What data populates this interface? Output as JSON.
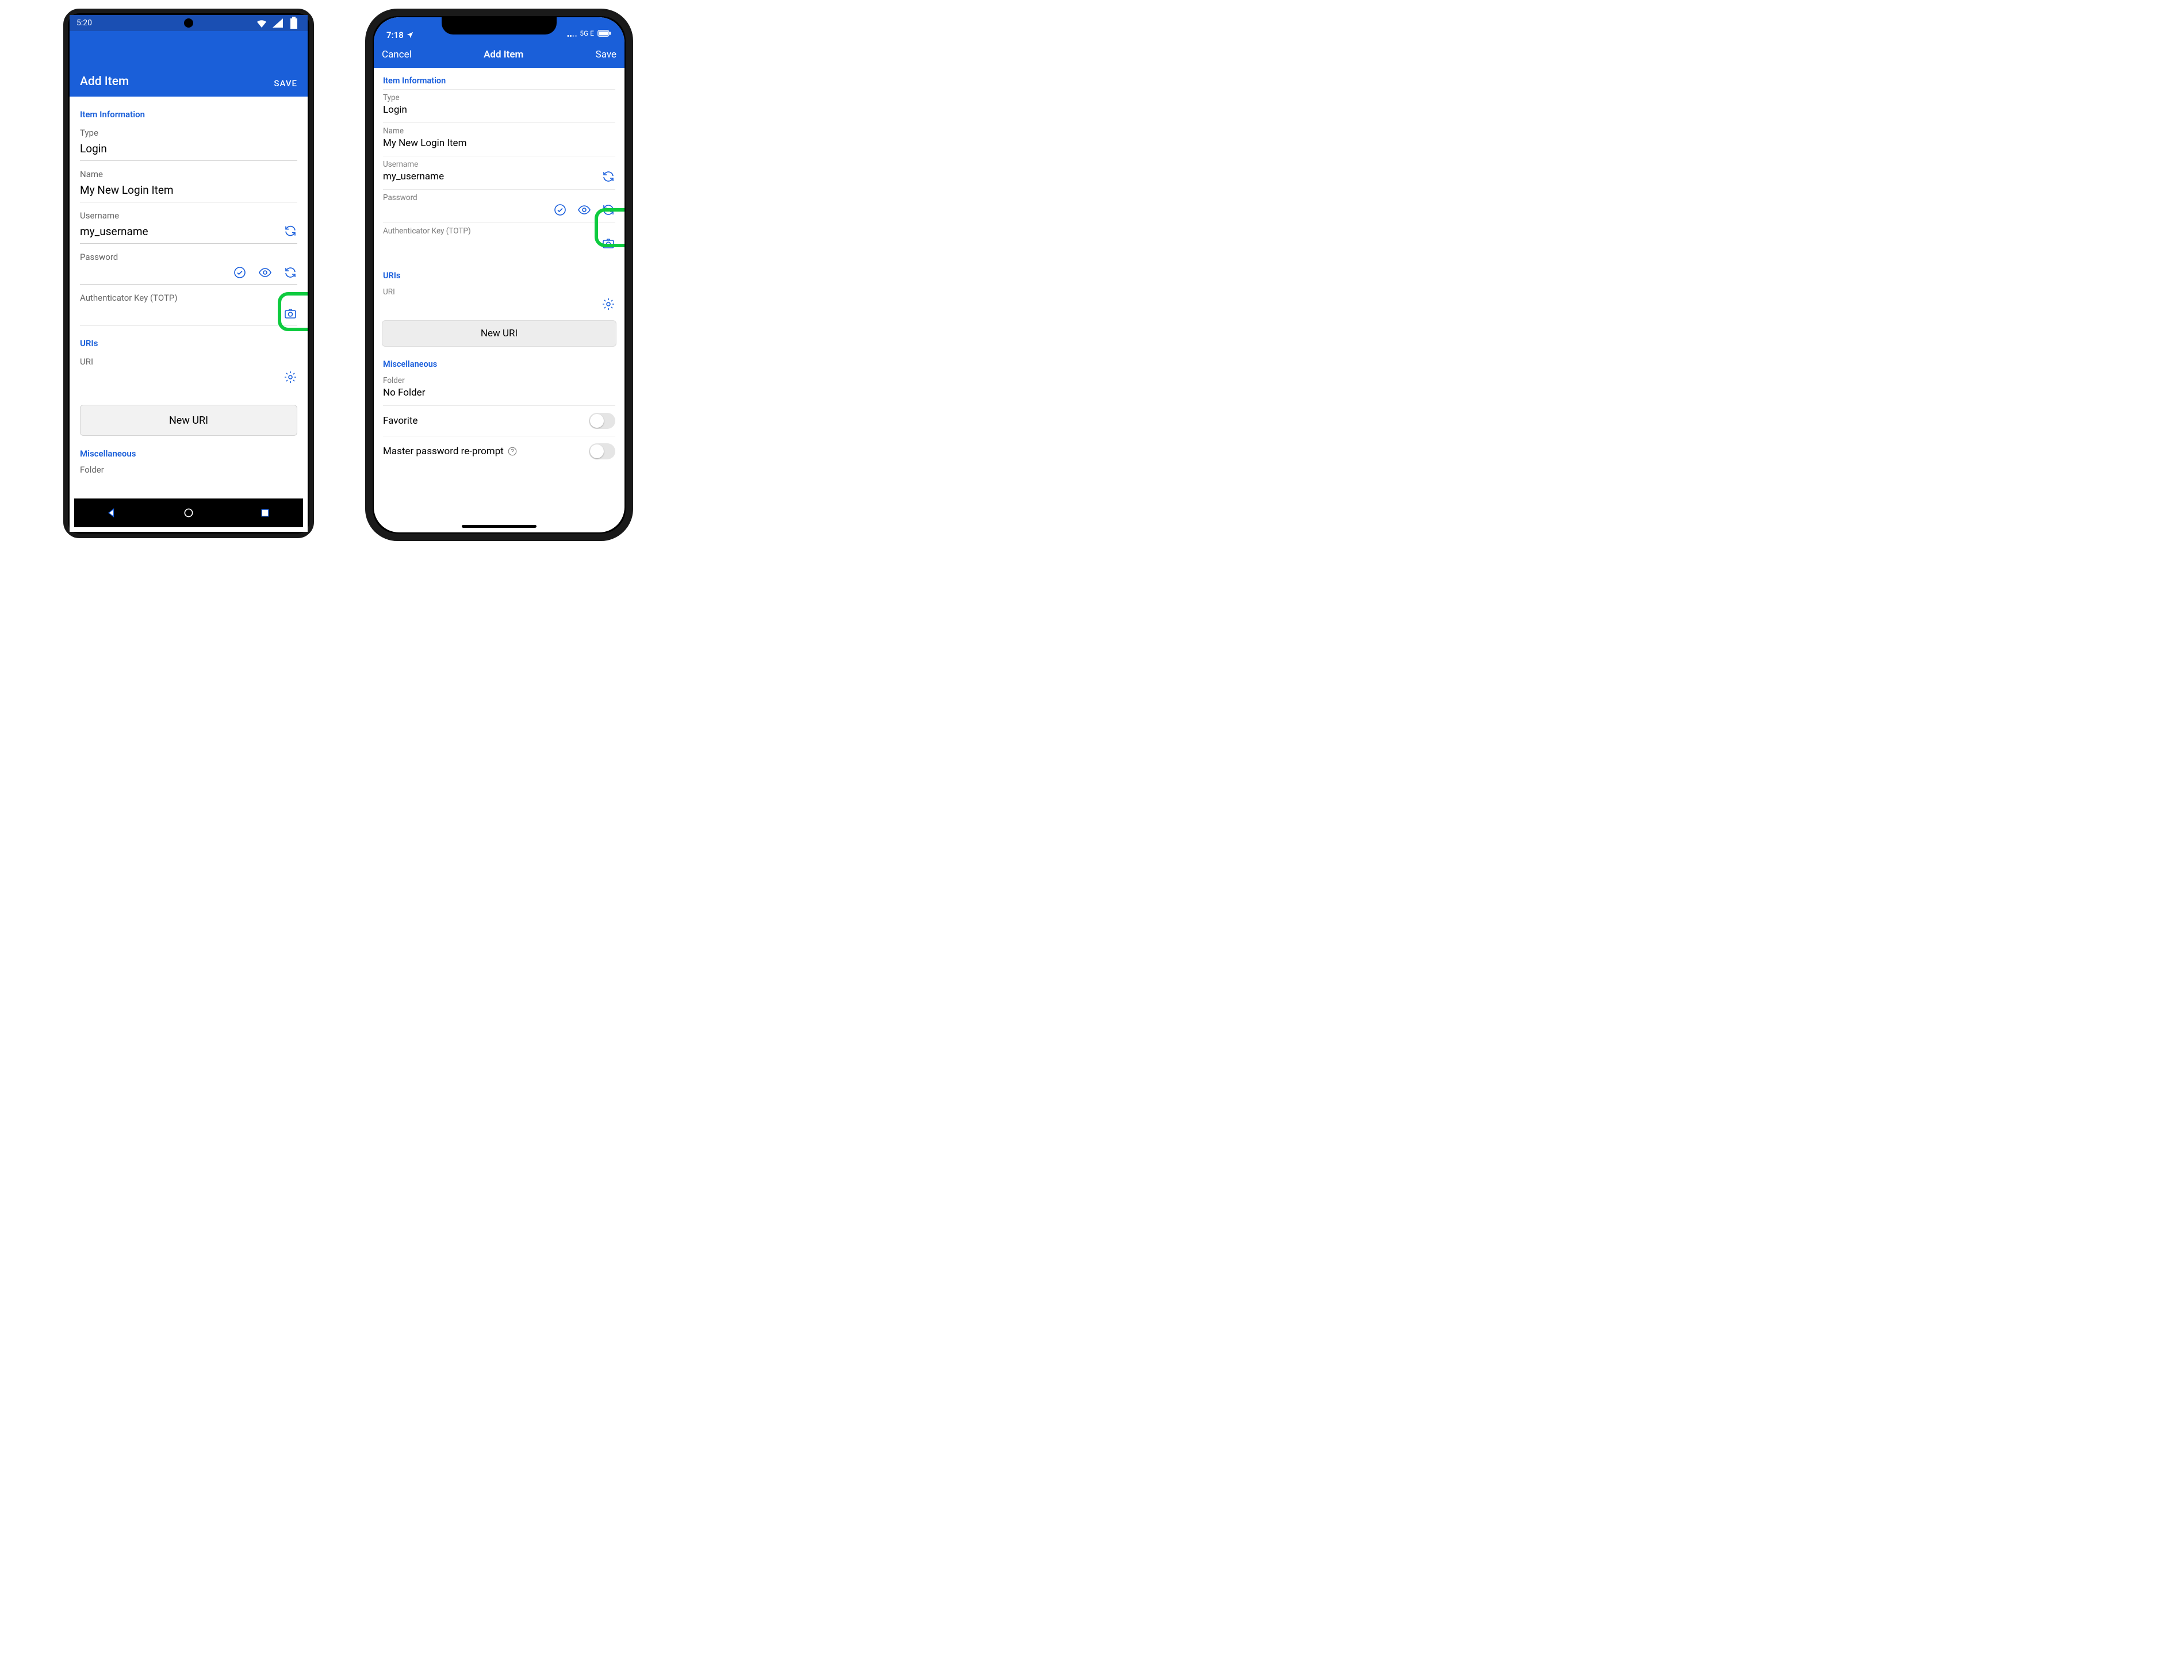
{
  "colors": {
    "accent": "#1a5fd9",
    "highlight": "#0ecb3f"
  },
  "android": {
    "status": {
      "time": "5:20"
    },
    "appbar": {
      "title": "Add Item",
      "save": "SAVE"
    },
    "sections": {
      "item_info": {
        "header": "Item Information"
      },
      "uris": {
        "header": "URIs"
      },
      "misc": {
        "header": "Miscellaneous"
      }
    },
    "fields": {
      "type": {
        "label": "Type",
        "value": "Login"
      },
      "name": {
        "label": "Name",
        "value": "My New Login Item"
      },
      "username": {
        "label": "Username",
        "value": "my_username"
      },
      "password": {
        "label": "Password",
        "value": ""
      },
      "totp": {
        "label": "Authenticator Key (TOTP)",
        "value": ""
      },
      "uri": {
        "label": "URI",
        "value": ""
      },
      "folder": {
        "label": "Folder"
      }
    },
    "buttons": {
      "new_uri": "New URI"
    }
  },
  "ios": {
    "status": {
      "time": "7:18",
      "network": "5G E"
    },
    "navbar": {
      "cancel": "Cancel",
      "title": "Add Item",
      "save": "Save"
    },
    "sections": {
      "item_info": {
        "header": "Item Information"
      },
      "uris": {
        "header": "URIs"
      },
      "misc": {
        "header": "Miscellaneous"
      }
    },
    "fields": {
      "type": {
        "label": "Type",
        "value": "Login"
      },
      "name": {
        "label": "Name",
        "value": "My New Login Item"
      },
      "username": {
        "label": "Username",
        "value": "my_username"
      },
      "password": {
        "label": "Password",
        "value": ""
      },
      "totp": {
        "label": "Authenticator Key (TOTP)",
        "value": ""
      },
      "uri": {
        "label": "URI",
        "value": ""
      },
      "folder": {
        "label": "Folder",
        "value": "No Folder"
      }
    },
    "buttons": {
      "new_uri": "New URI"
    },
    "toggles": {
      "favorite": {
        "label": "Favorite",
        "on": false
      },
      "reprompt": {
        "label": "Master password re-prompt",
        "on": false
      }
    }
  }
}
